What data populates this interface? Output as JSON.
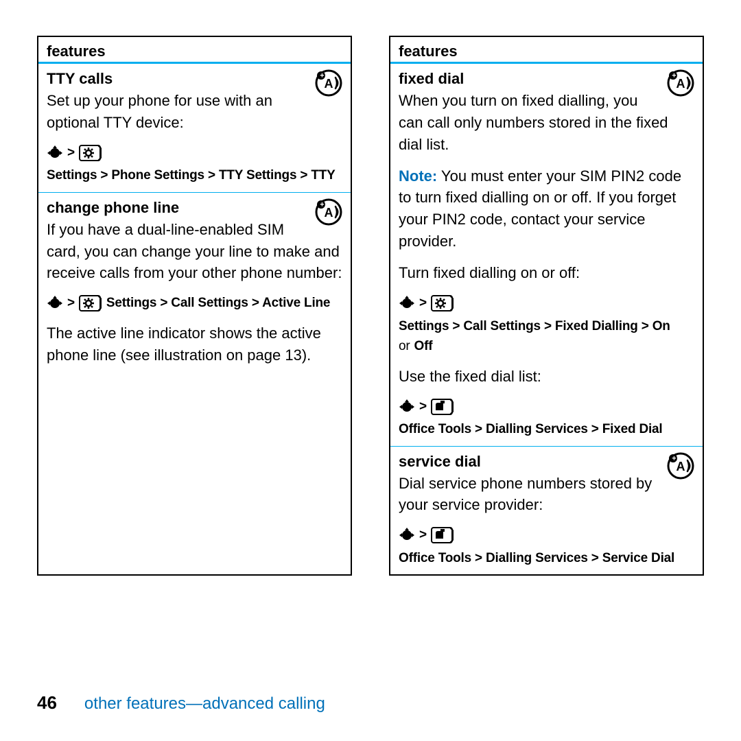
{
  "left": {
    "header": "features",
    "s1": {
      "title": "TTY calls",
      "body": "Set up your phone for use with an optional TTY device:",
      "nav": "Settings > Phone Settings > TTY Settings > TTY"
    },
    "s2": {
      "title": "change phone line",
      "body": "If you have a dual-line-enabled SIM card, you can change your line to make and receive calls from your other phone number:",
      "nav": "Settings > Call Settings > Active Line",
      "after": "The active line indicator shows the active phone line (see illustration on page 13)."
    }
  },
  "right": {
    "header": "features",
    "s1": {
      "title": "fixed dial",
      "body": "When you turn on fixed dialling, you can call only numbers stored in the fixed dial list.",
      "note_label": "Note:",
      "note_body": " You must enter your SIM PIN2 code to turn fixed dialling on or off. If you forget your PIN2 code, contact your service provider.",
      "lead1": "Turn fixed dialling on or off:",
      "nav1a": "Settings > Call Settings > Fixed Dialling > On",
      "nav1b_prefix": "or ",
      "nav1b_off": "Off",
      "lead2": "Use the fixed dial list:",
      "nav2": "Office Tools > Dialling Services > Fixed Dial"
    },
    "s2": {
      "title": "service dial",
      "body": "Dial service phone numbers stored by your service provider:",
      "nav": "Office Tools > Dialling Services > Service Dial"
    }
  },
  "footer": {
    "page": "46",
    "title": "other features—advanced calling"
  }
}
